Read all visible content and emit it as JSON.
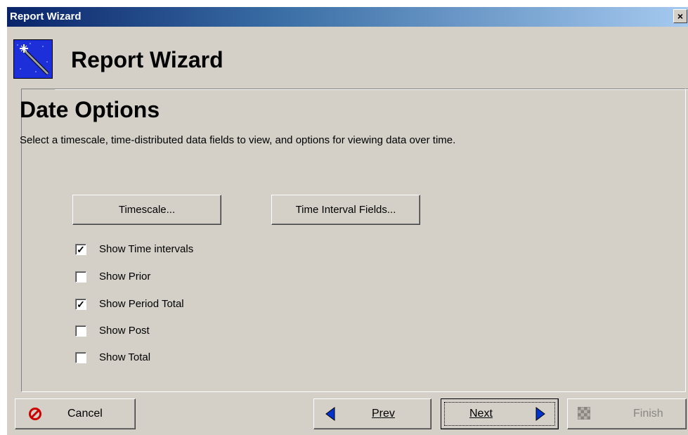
{
  "window": {
    "title": "Report Wizard",
    "close_label": "×"
  },
  "header": {
    "icon": "magic-wand-icon",
    "title": "Report Wizard"
  },
  "section": {
    "title": "Date Options",
    "description": "Select a timescale, time-distributed data fields to view, and options for viewing data over time."
  },
  "buttons": {
    "timescale": "Timescale...",
    "time_interval_fields": "Time Interval Fields..."
  },
  "options": [
    {
      "label": "Show Time intervals",
      "checked": true
    },
    {
      "label": "Show Prior",
      "checked": false
    },
    {
      "label": "Show Period Total",
      "checked": true
    },
    {
      "label": "Show Post",
      "checked": false
    },
    {
      "label": "Show Total",
      "checked": false
    }
  ],
  "footer": {
    "cancel_label": "Cancel",
    "prev_label": "Prev",
    "next_label": "Next",
    "finish_label": "Finish",
    "finish_enabled": false
  },
  "colors": {
    "titlebar_start": "#0a246a",
    "titlebar_end": "#a6caf0",
    "face": "#d4d0c8",
    "cancel_icon": "#cc0000",
    "arrow_blue": "#0033cc"
  }
}
